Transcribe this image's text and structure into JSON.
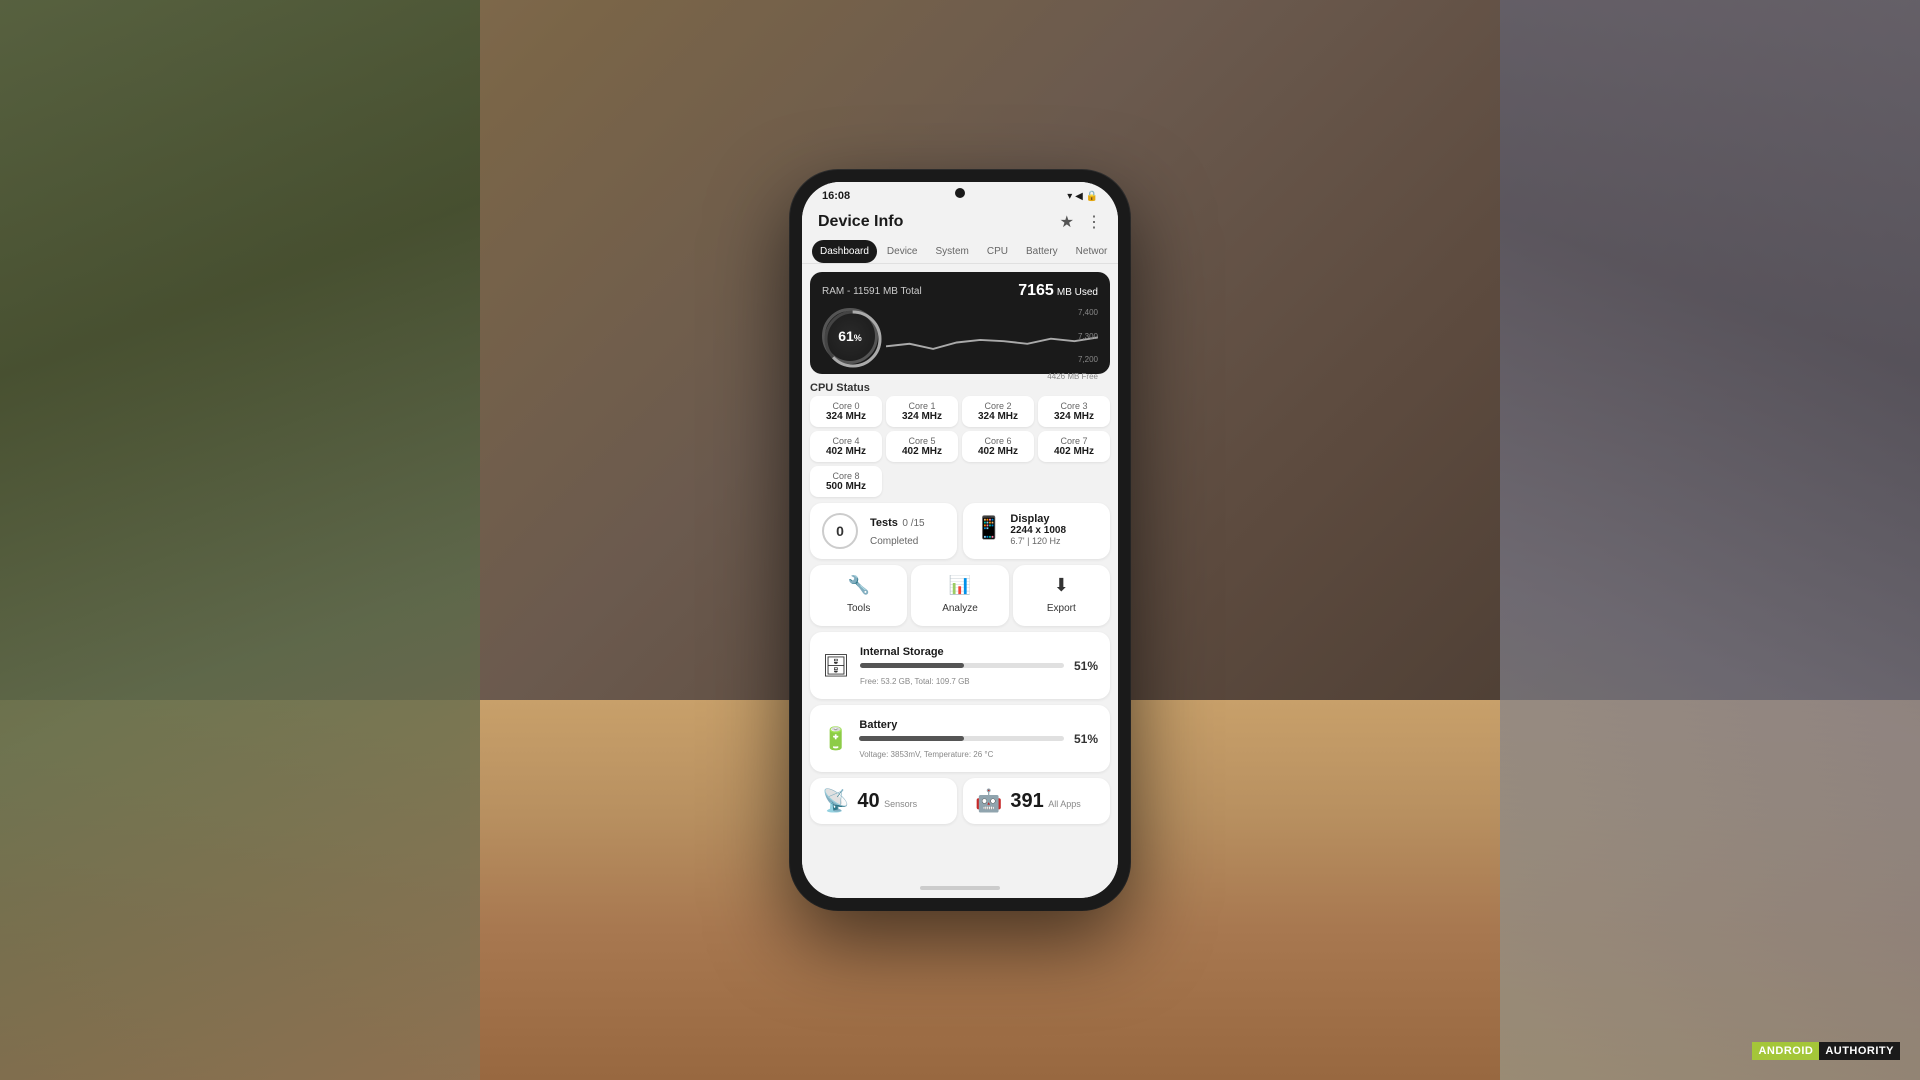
{
  "background": {
    "color": "#6b5a4e"
  },
  "statusBar": {
    "time": "16:08",
    "icons": "▾ ◀ 🔒"
  },
  "appHeader": {
    "title": "Device Info",
    "starIcon": "★",
    "menuIcon": "⋮"
  },
  "tabs": [
    {
      "label": "Dashboard",
      "active": true
    },
    {
      "label": "Device",
      "active": false
    },
    {
      "label": "System",
      "active": false
    },
    {
      "label": "CPU",
      "active": false
    },
    {
      "label": "Battery",
      "active": false
    },
    {
      "label": "Networ",
      "active": false
    }
  ],
  "ram": {
    "title": "RAM - 11591 MB Total",
    "usedLabel": "MB Used",
    "usedValue": "7165",
    "percentage": "61",
    "percentSymbol": "%",
    "freeLabel": "4426 MB Free",
    "scaleValues": [
      "7,400",
      "7,300",
      "7,200"
    ]
  },
  "cpuStatus": {
    "label": "CPU Status",
    "cores": [
      {
        "name": "Core 0",
        "freq": "324 MHz"
      },
      {
        "name": "Core 1",
        "freq": "324 MHz"
      },
      {
        "name": "Core 2",
        "freq": "324 MHz"
      },
      {
        "name": "Core 3",
        "freq": "324 MHz"
      },
      {
        "name": "Core 4",
        "freq": "402 MHz"
      },
      {
        "name": "Core 5",
        "freq": "402 MHz"
      },
      {
        "name": "Core 6",
        "freq": "402 MHz"
      },
      {
        "name": "Core 7",
        "freq": "402 MHz"
      },
      {
        "name": "Core 8",
        "freq": "500 MHz"
      }
    ]
  },
  "tests": {
    "title": "Tests",
    "count": "0",
    "outOf": "0 /15",
    "completedLabel": "Completed",
    "badge": "0"
  },
  "display": {
    "title": "Display",
    "resolution": "2244 x 1008",
    "size": "6.7'",
    "refreshRate": "120 Hz"
  },
  "actions": [
    {
      "label": "Tools",
      "icon": "🔧"
    },
    {
      "label": "Analyze",
      "icon": "📊"
    },
    {
      "label": "Export",
      "icon": "⬇"
    }
  ],
  "internalStorage": {
    "title": "Internal Storage",
    "free": "Free: 53.2 GB",
    "total": "Total: 109.7 GB",
    "percentage": 51,
    "percentageLabel": "51%"
  },
  "battery": {
    "title": "Battery",
    "voltage": "Voltage: 3853mV",
    "temperature": "Temperature: 26 °C",
    "percentage": 51,
    "percentageLabel": "51%"
  },
  "sensors": {
    "count": "40",
    "label": "Sensors"
  },
  "apps": {
    "count": "391",
    "label": "All Apps"
  },
  "watermark": {
    "android": "ANDROID",
    "authority": "AUTHORITY"
  }
}
